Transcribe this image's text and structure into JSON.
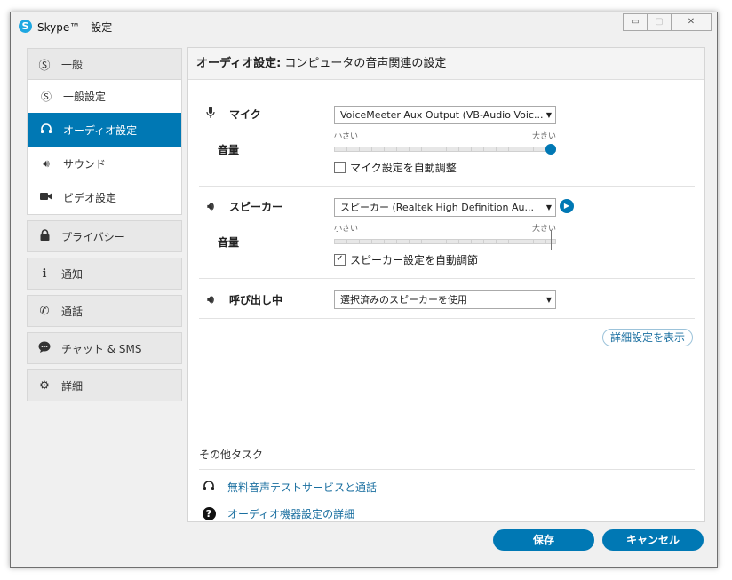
{
  "window": {
    "title": "Skype™ - 設定",
    "app_icon_letter": "S",
    "min_glyph": "▭",
    "max_glyph": "▢",
    "close_glyph": "✕"
  },
  "sidebar": {
    "general": {
      "label": "一般",
      "icon": "skype-icon"
    },
    "sub_items": [
      {
        "label": "一般設定",
        "icon": "skype-icon"
      },
      {
        "label": "オーディオ設定",
        "icon": "headset-icon",
        "active": true
      },
      {
        "label": "サウンド",
        "icon": "speaker-icon"
      },
      {
        "label": "ビデオ設定",
        "icon": "video-camera-icon"
      }
    ],
    "items": [
      {
        "label": "プライバシー",
        "icon": "lock-icon"
      },
      {
        "label": "通知",
        "icon": "info-icon"
      },
      {
        "label": "通話",
        "icon": "phone-icon"
      },
      {
        "label": "チャット & SMS",
        "icon": "chat-icon"
      },
      {
        "label": "詳細",
        "icon": "gear-icon"
      }
    ]
  },
  "header": {
    "title_bold": "オーディオ設定:",
    "title_rest": " コンピュータの音声関連の設定"
  },
  "mic": {
    "label": "マイク",
    "device": "VoiceMeeter Aux Output (VB-Audio Voic...",
    "volume_label": "音量",
    "scale_min": "小さい",
    "scale_max": "大きい",
    "volume_level": 1.0,
    "auto_adjust_label": "マイク設定を自動調整",
    "auto_adjust_checked": false
  },
  "speaker": {
    "label": "スピーカー",
    "device": "スピーカー (Realtek High Definition Au...",
    "volume_label": "音量",
    "scale_min": "小さい",
    "scale_max": "大きい",
    "volume_level": 1.0,
    "auto_adjust_label": "スピーカー設定を自動調節",
    "auto_adjust_checked": true
  },
  "ringing": {
    "label": "呼び出し中",
    "device": "選択済みのスピーカーを使用"
  },
  "advanced_button": "詳細設定を表示",
  "other_tasks": {
    "heading": "その他タスク",
    "links": [
      {
        "label": "無料音声テストサービスと通話",
        "icon": "headset-icon"
      },
      {
        "label": "オーディオ機器設定の詳細",
        "icon": "help-icon"
      }
    ]
  },
  "footer": {
    "save": "保存",
    "cancel": "キャンセル"
  },
  "colors": {
    "accent": "#0078b4",
    "link": "#1a6fa0"
  }
}
